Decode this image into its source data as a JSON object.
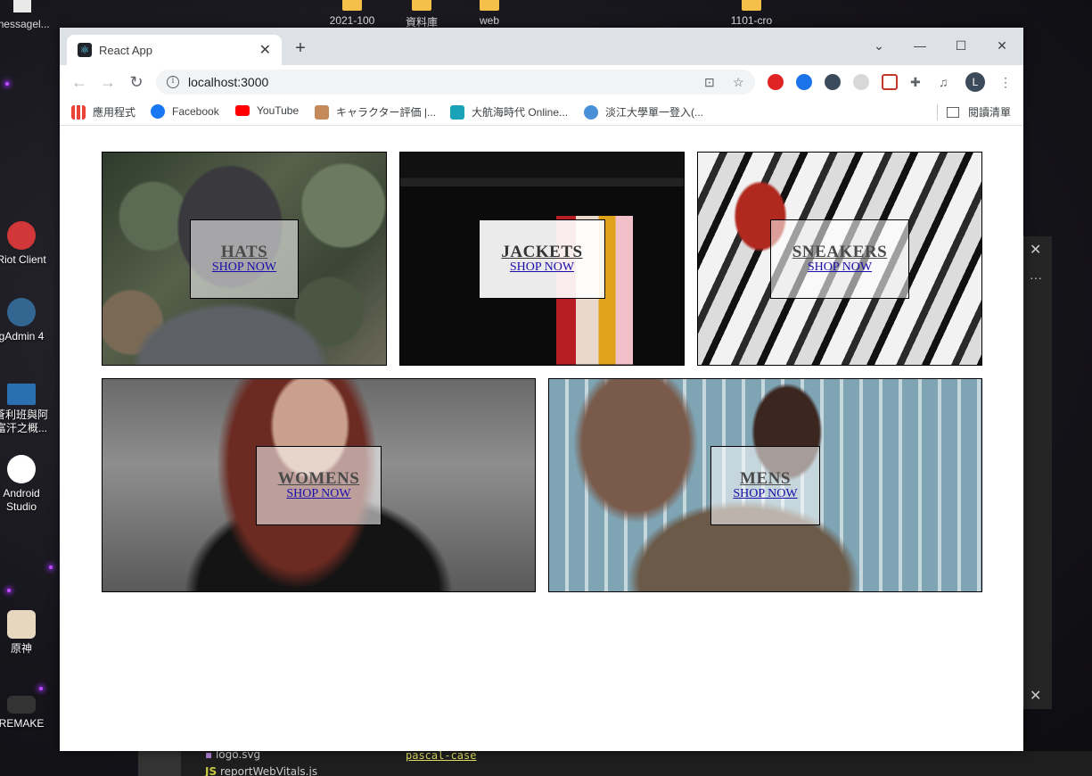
{
  "desktop": {
    "top_icons": [
      {
        "label": "messagel...",
        "name": "file"
      },
      {
        "label": "2021-100",
        "name": "folder"
      },
      {
        "label": "資料庫",
        "name": "folder"
      },
      {
        "label": "web",
        "name": "folder"
      },
      {
        "label": "1101-cro",
        "name": "folder"
      }
    ],
    "side_icons": [
      {
        "label": "Riot Client",
        "color": "#d13639"
      },
      {
        "label": "gAdmin 4",
        "color": "#336791"
      },
      {
        "label": "蒼利班與阿富汗之概...",
        "color": "#2a6fb0"
      },
      {
        "label": "Android Studio",
        "color": "#3ddc84"
      },
      {
        "label": "原神",
        "color": "#e8d7c0"
      },
      {
        "label": "REMAKE",
        "color": "#444"
      }
    ],
    "vscode_files": [
      "logo.svg",
      "reportWebVitals.js"
    ],
    "vscode_code": "pascal-case"
  },
  "browser": {
    "tab_title": "React App",
    "url": "localhost:3000",
    "bookmarks": [
      {
        "label": "應用程式",
        "color": "#4285f4"
      },
      {
        "label": "Facebook",
        "color": "#1877f2"
      },
      {
        "label": "YouTube",
        "color": "#ff0000"
      },
      {
        "label": "キャラクター評価 |...",
        "color": "#c58a5a"
      },
      {
        "label": "大航海時代 Online...",
        "color": "#1aa3b8"
      },
      {
        "label": "淡江大學單一登入(...",
        "color": "#4a90d9"
      }
    ],
    "reading_list": "閱讀清單",
    "profile_initial": "L"
  },
  "directory": {
    "sections": [
      {
        "title": "HATS",
        "subtitle": "SHOP NOW"
      },
      {
        "title": "JACKETS",
        "subtitle": "SHOP NOW"
      },
      {
        "title": "SNEAKERS",
        "subtitle": "SHOP NOW"
      },
      {
        "title": "WOMENS",
        "subtitle": "SHOP NOW"
      },
      {
        "title": "MENS",
        "subtitle": "SHOP NOW"
      }
    ]
  }
}
